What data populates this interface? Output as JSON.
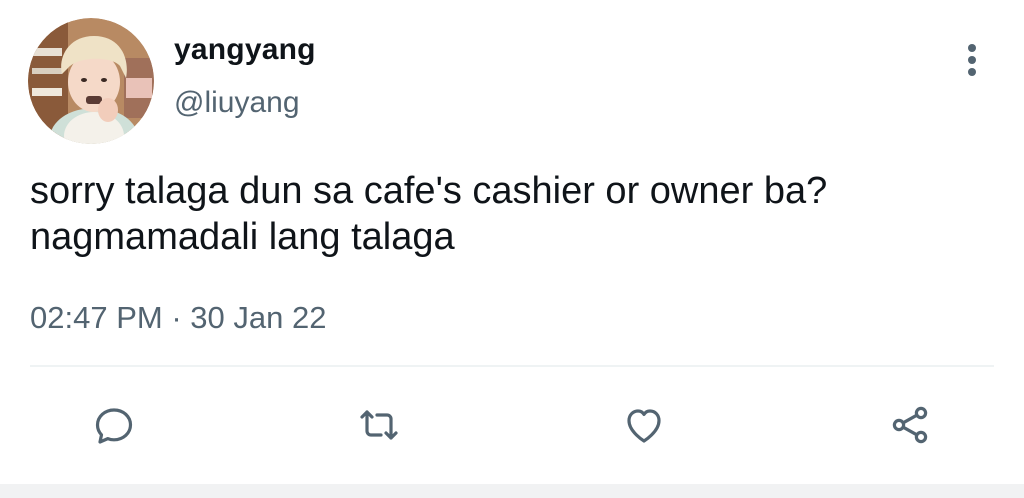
{
  "user": {
    "display_name": "yangyang",
    "handle": "@liuyang"
  },
  "tweet": {
    "text_line1": "sorry talaga dun sa cafe's cashier or owner ba?",
    "text_line2": "nagmamadali lang talaga",
    "time": "02:47 PM",
    "separator": "·",
    "date": "30 Jan 22"
  },
  "actions": {
    "reply_icon": "reply-icon",
    "retweet_icon": "retweet-icon",
    "like_icon": "heart-icon",
    "share_icon": "share-icon",
    "more_icon": "more-vertical-icon"
  },
  "colors": {
    "text_primary": "#0f1419",
    "text_secondary": "#536471",
    "divider": "#eff3f4"
  }
}
